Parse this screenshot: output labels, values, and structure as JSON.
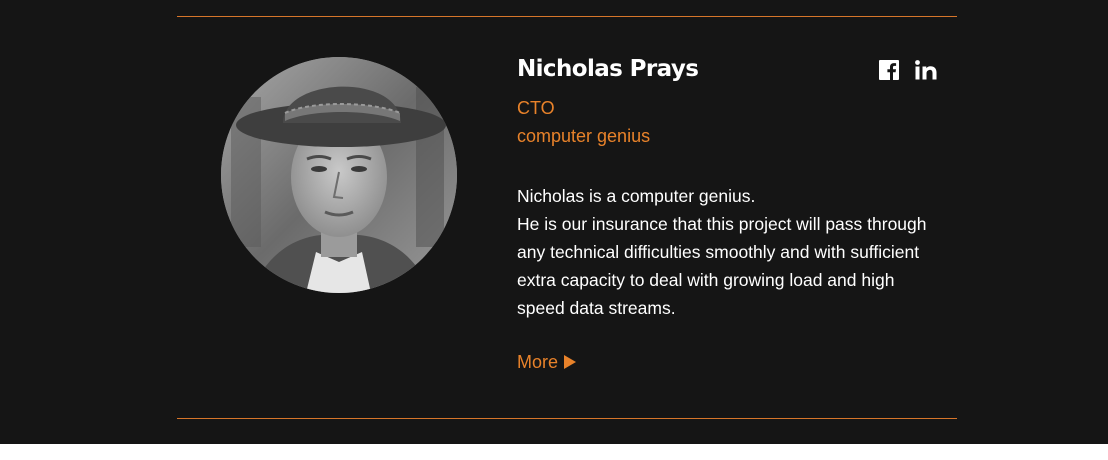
{
  "profile": {
    "name": "Nicholas Prays",
    "title": "CTO",
    "subtitle": "computer genius",
    "bio_lines": [
      "Nicholas is a computer genius.",
      "He is our insurance that this project will pass through",
      "any technical difficulties smoothly and with sufficient",
      "extra capacity to deal with growing load and high",
      "speed data streams."
    ],
    "more_label": "More",
    "photo_icon": "person-photo"
  },
  "social": {
    "facebook_icon": "facebook-icon",
    "linkedin_icon": "linkedin-icon"
  },
  "colors": {
    "background": "#151515",
    "accent": "#e8822a",
    "text": "#ffffff",
    "divider": "#d6752a"
  }
}
